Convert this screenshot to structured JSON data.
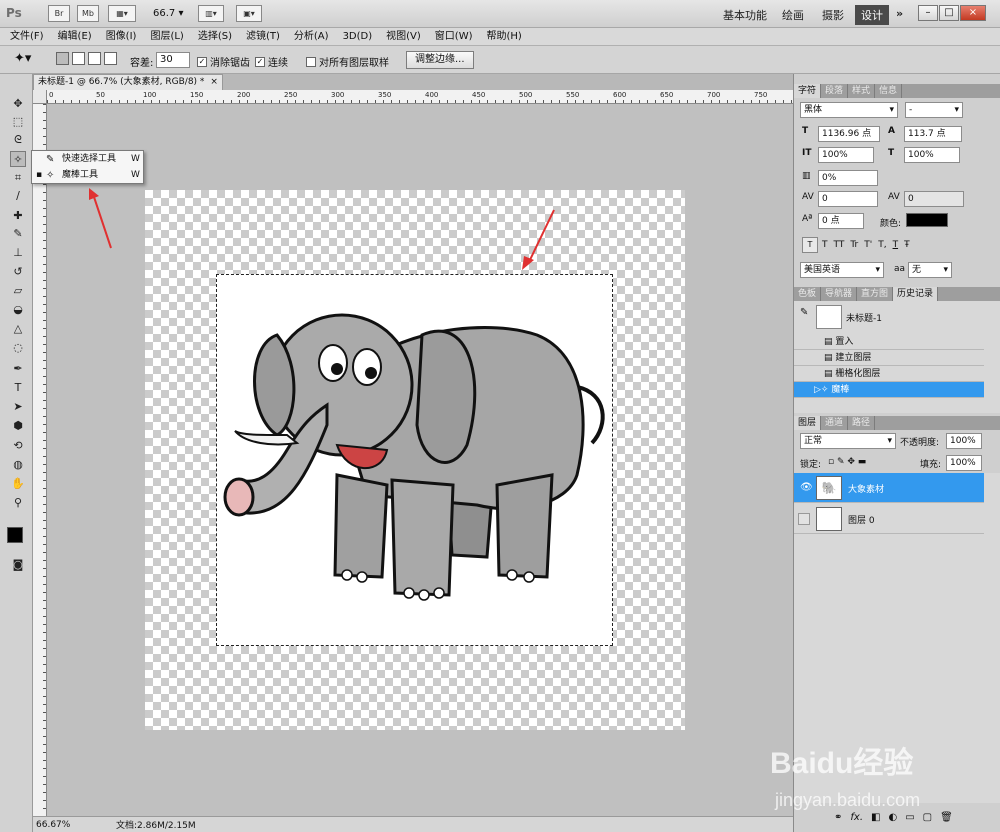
{
  "app": {
    "logo": "Ps",
    "toolbar_icons": [
      "Br",
      "Mb"
    ],
    "zoom": "66.7",
    "workspaces": [
      "基本功能",
      "绘画",
      "摄影",
      "设计"
    ],
    "workspace_active": "设计",
    "more": "»"
  },
  "window_buttons": {
    "minimize": "–",
    "restore": "□",
    "close": "×"
  },
  "menu": [
    "文件(F)",
    "编辑(E)",
    "图像(I)",
    "图层(L)",
    "选择(S)",
    "滤镜(T)",
    "分析(A)",
    "3D(D)",
    "视图(V)",
    "窗口(W)",
    "帮助(H)"
  ],
  "options": {
    "tolerance_label": "容差:",
    "tolerance_value": "30",
    "antialias_label": "消除锯齿",
    "contiguous_label": "连续",
    "sample_all_label": "对所有图层取样",
    "refine_edge_label": "调整边缘..."
  },
  "document": {
    "tab_label": "未标题-1 @ 66.7% (大象素材, RGB/8) *",
    "tab_close": "×"
  },
  "ruler_ticks": [
    "0",
    "50",
    "100",
    "150",
    "200",
    "250",
    "300",
    "350",
    "400",
    "450",
    "500",
    "550",
    "600",
    "650",
    "700",
    "750"
  ],
  "tool_flyout": {
    "items": [
      {
        "label": "快速选择工具",
        "key": "W"
      },
      {
        "label": "魔棒工具",
        "key": "W"
      }
    ]
  },
  "status": {
    "zoom": "66.67%",
    "doc": "文档:2.86M/2.15M"
  },
  "character_panel": {
    "tabs": [
      "字符",
      "段落",
      "样式",
      "信息"
    ],
    "font_family": "黑体",
    "font_style": "-",
    "size": "1136.96 点",
    "leading": "113.7 点",
    "vscale": "100%",
    "hscale": "100%",
    "tracking_pct": "0%",
    "kerning": "0",
    "tracking": "0",
    "baseline": "0 点",
    "color_label": "颜色:",
    "language": "美国英语",
    "aa_label": "aa",
    "antialias": "无",
    "type_buttons": [
      "T",
      "T",
      "TT",
      "Tr",
      "T'",
      "T,",
      "T",
      "Ŧ"
    ]
  },
  "history_panel": {
    "tabs": [
      "色板",
      "导航器",
      "直方图",
      "历史记录"
    ],
    "snapshot": "未标题-1",
    "items": [
      "置入",
      "建立图层",
      "栅格化图层",
      "魔棒"
    ],
    "selected": "魔棒"
  },
  "layers_panel": {
    "tabs": [
      "图层",
      "通道",
      "路径"
    ],
    "blend_mode": "正常",
    "opacity_label": "不透明度:",
    "opacity": "100%",
    "lock_label": "锁定:",
    "fill_label": "填充:",
    "fill": "100%",
    "layers": [
      {
        "name": "大象素材",
        "visible": true,
        "selected": true
      },
      {
        "name": "图层 0",
        "visible": false,
        "selected": false
      }
    ],
    "footer_icons": [
      "link-icon",
      "fx-icon",
      "mask-icon",
      "adjustment-icon",
      "group-icon",
      "new-layer-icon",
      "trash-icon"
    ]
  },
  "watermark": {
    "brand": "Baidu经验",
    "url": "jingyan.baidu.com"
  },
  "colors": {
    "accent_selected": "#3399ee",
    "foreground": "#000000",
    "background": "#e05a2a",
    "annotation_arrow": "#e03030"
  }
}
